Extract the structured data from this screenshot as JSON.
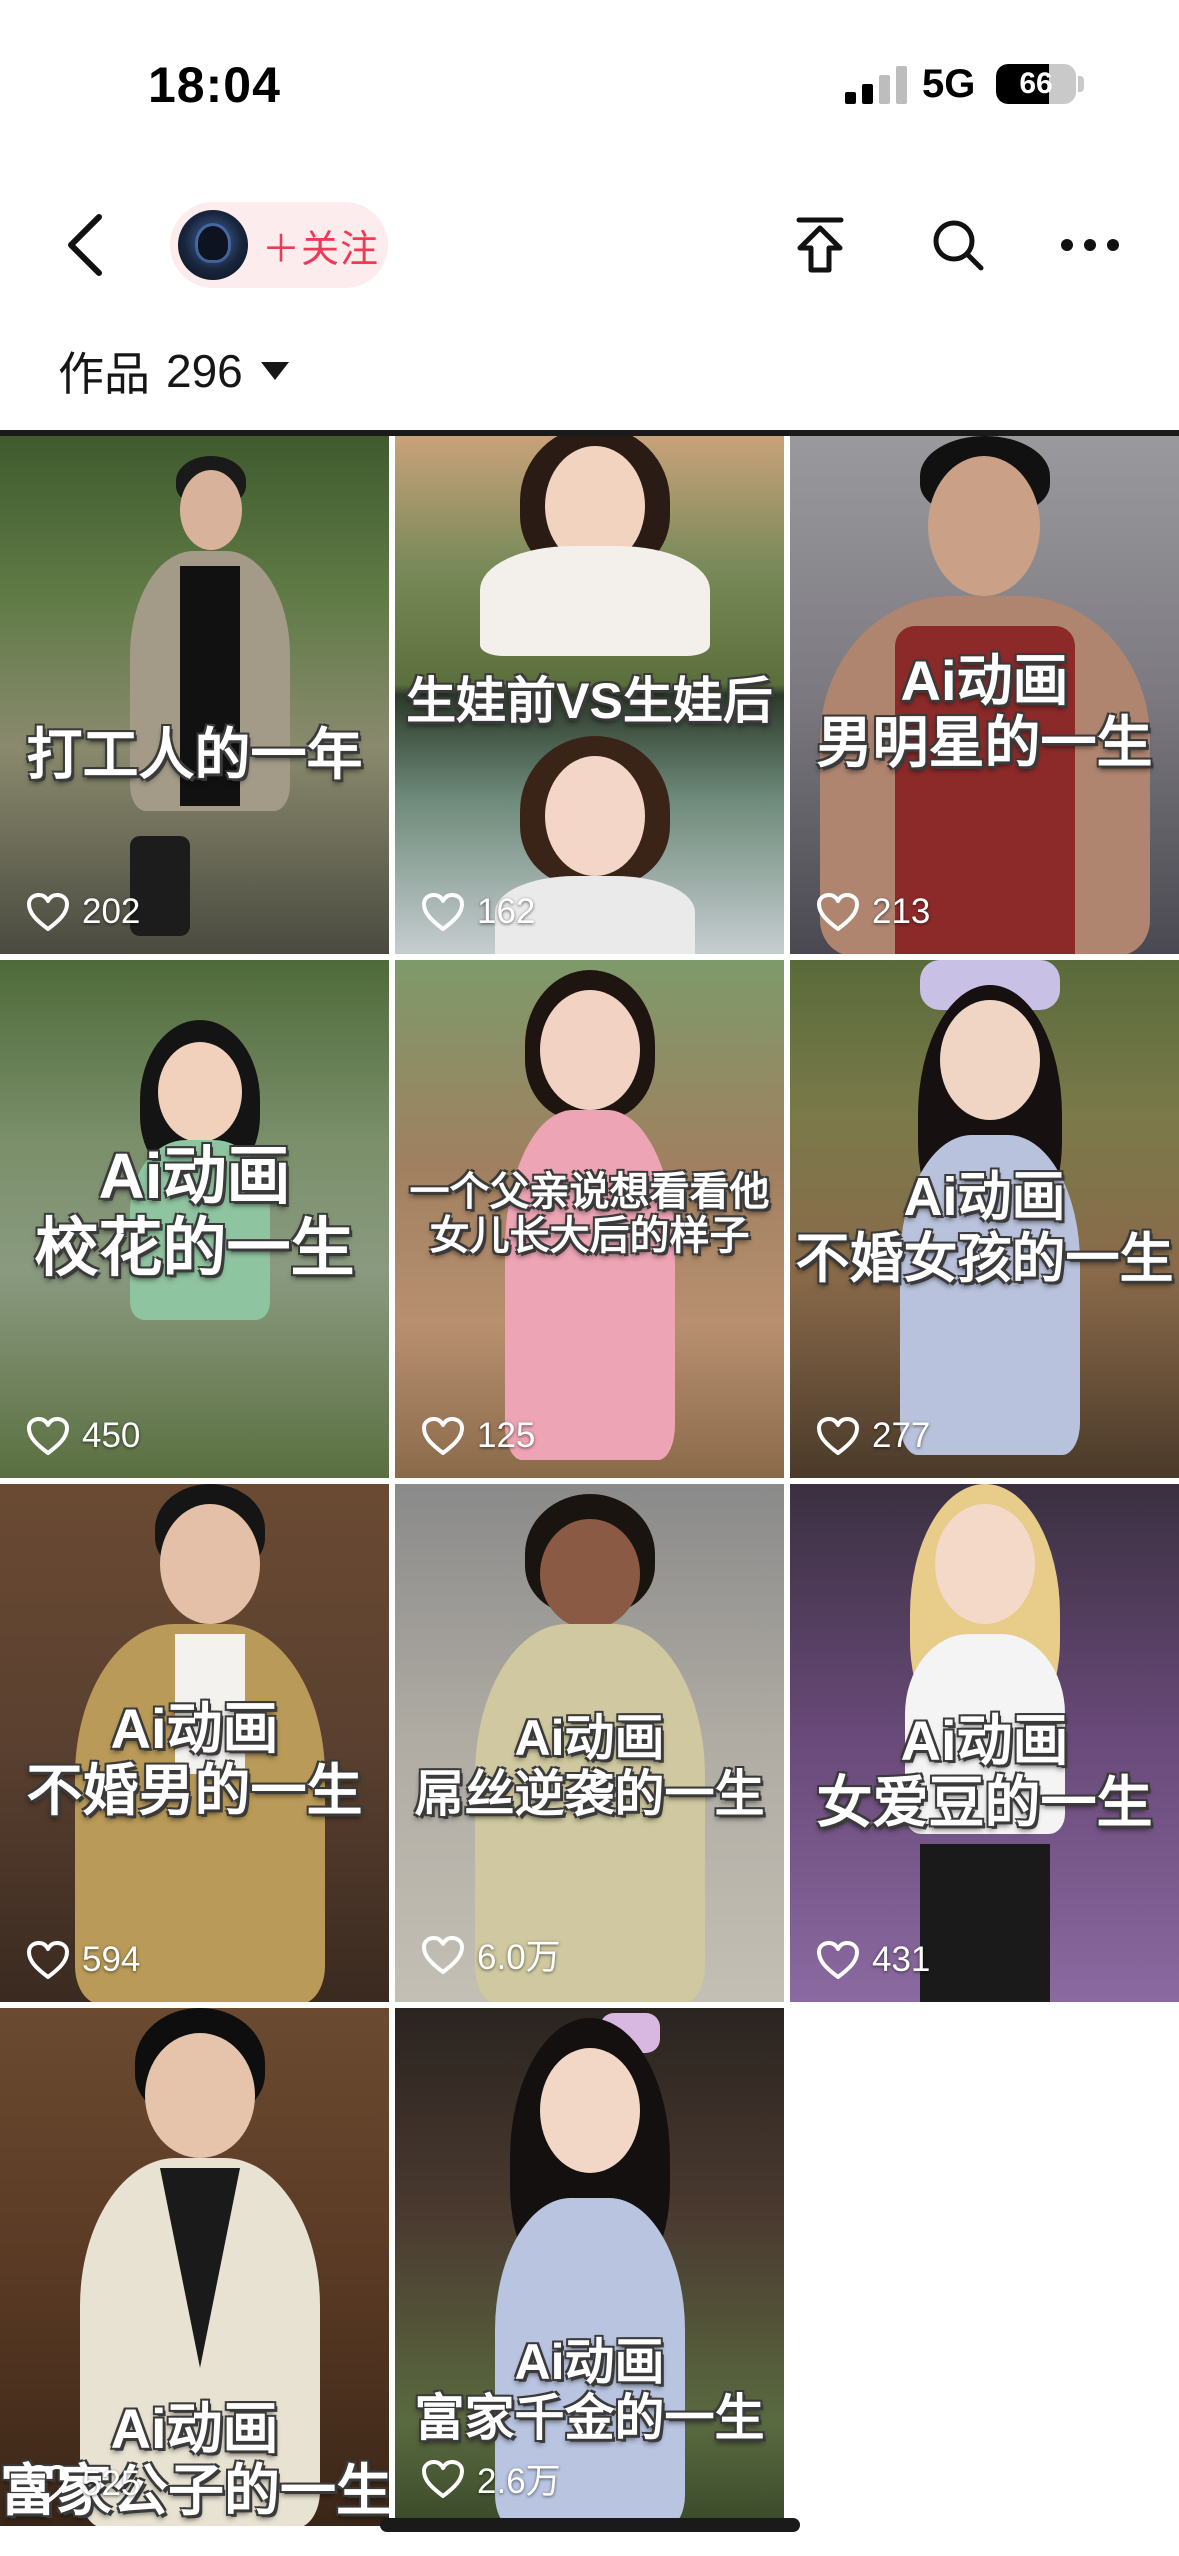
{
  "status_bar": {
    "time": "18:04",
    "network": "5G",
    "battery_level": "66",
    "battery_fraction": 0.66
  },
  "nav": {
    "follow_label": "＋关注",
    "icons": [
      "back-icon",
      "share-icon",
      "search-icon",
      "more-icon"
    ]
  },
  "tab": {
    "label": "作品",
    "count": "296"
  },
  "videos": [
    {
      "caption": [
        "打工人的一年"
      ],
      "likes": "202"
    },
    {
      "caption": [
        "生娃前VS生娃后"
      ],
      "likes": "162"
    },
    {
      "caption": [
        "Ai动画",
        "男明星的一生"
      ],
      "likes": "213"
    },
    {
      "caption": [
        "Ai动画",
        "校花的一生"
      ],
      "likes": "450"
    },
    {
      "caption": [
        "一个父亲说想看看他",
        "女儿长大后的样子"
      ],
      "likes": "125"
    },
    {
      "caption": [
        "Ai动画",
        "不婚女孩的一生"
      ],
      "likes": "277"
    },
    {
      "caption": [
        "Ai动画",
        "不婚男的一生"
      ],
      "likes": "594"
    },
    {
      "caption": [
        "Ai动画",
        "屌丝逆袭的一生"
      ],
      "likes": "6.0万"
    },
    {
      "caption": [
        "Ai动画",
        "女爱豆的一生"
      ],
      "likes": "431"
    },
    {
      "caption": [
        "Ai动画",
        "富家公子的一生"
      ],
      "likes": "525"
    },
    {
      "caption": [
        "Ai动画",
        "富家千金的一生"
      ],
      "likes": "2.6万"
    }
  ],
  "colors": {
    "accent": "#f03a55",
    "follow_bg": "#fdecee"
  }
}
